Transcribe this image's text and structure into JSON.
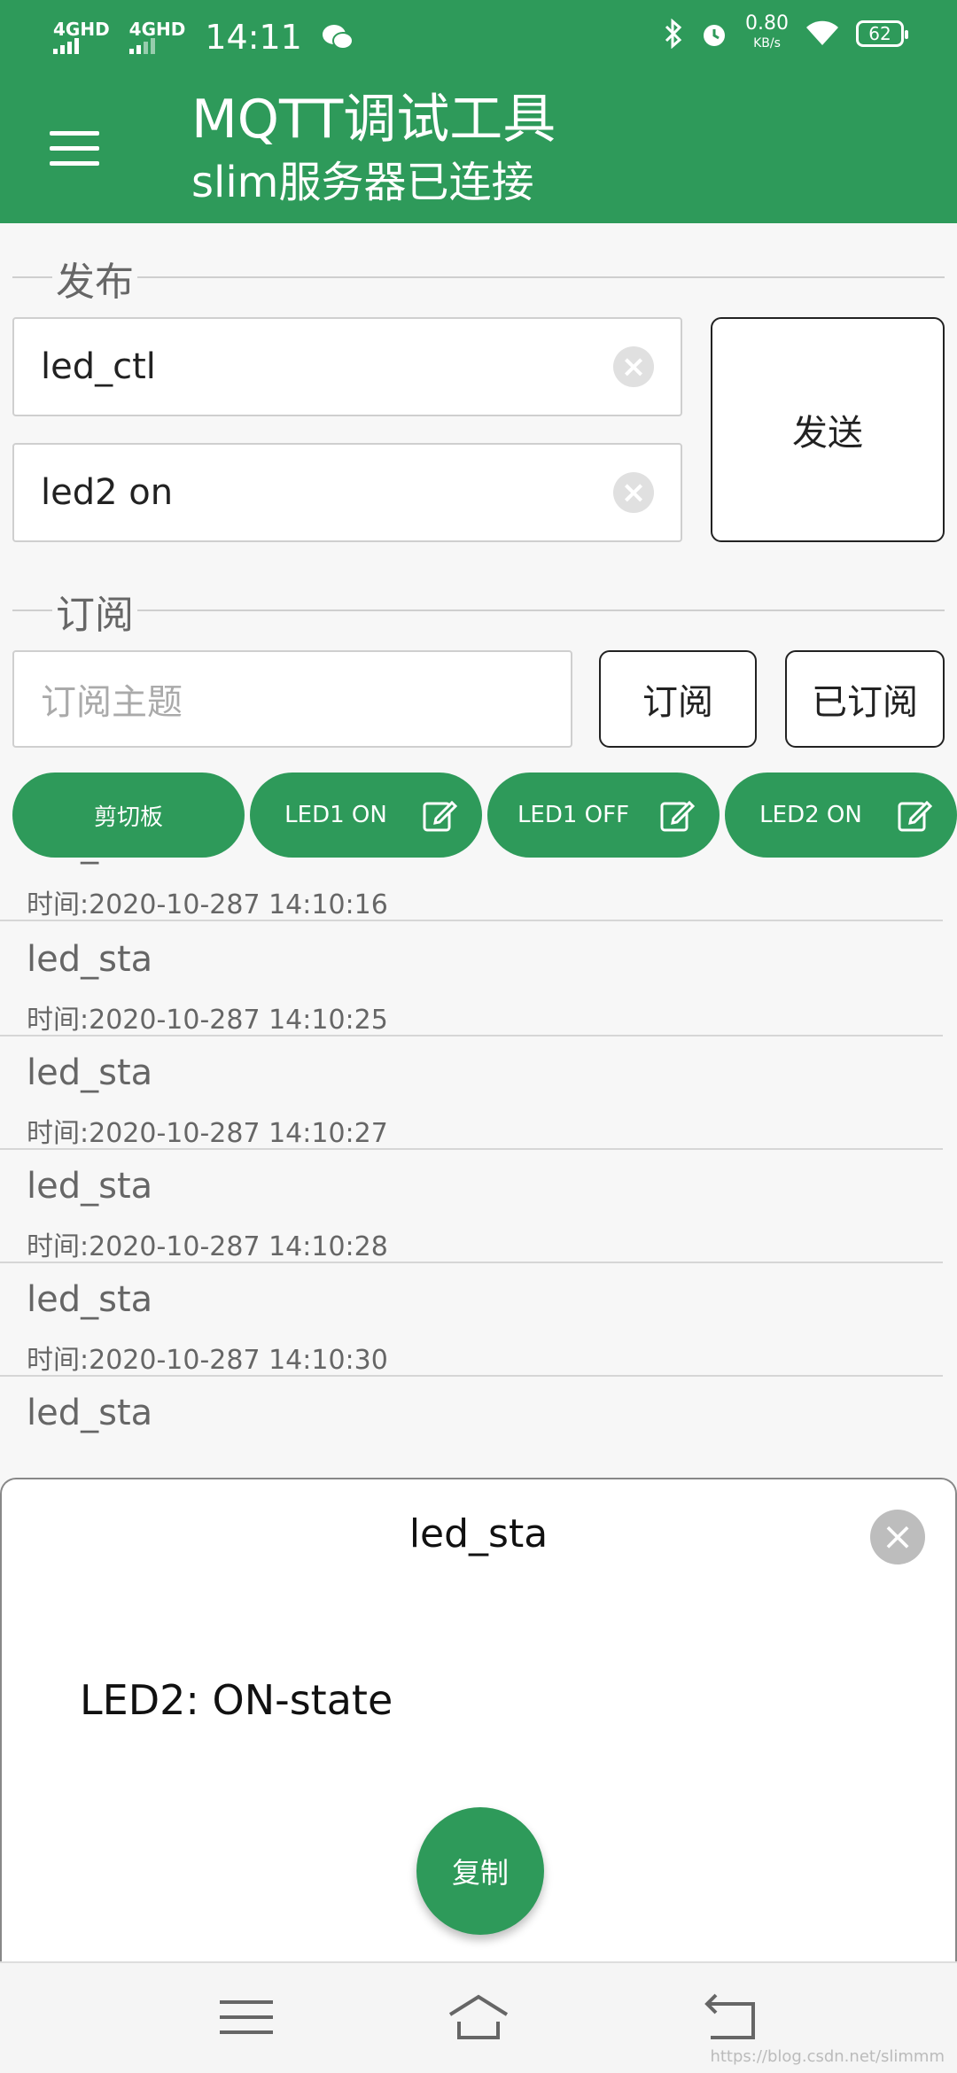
{
  "status_bar": {
    "signal1": "4GHD",
    "signal2": "4GHD",
    "time": "14:11",
    "net_speed": "0.80",
    "net_speed_unit": "KB/s",
    "battery": "62"
  },
  "appbar": {
    "title": "MQTT调试工具",
    "subtitle": "slim服务器已连接"
  },
  "publish": {
    "section_label": "发布",
    "topic_value": "led_ctl",
    "message_value": "led2 on",
    "send_label": "发送"
  },
  "subscribe": {
    "section_label": "订阅",
    "topic_placeholder": "订阅主题",
    "subscribe_label": "订阅",
    "subscribed_label": "已订阅"
  },
  "chips": {
    "clipboard": "剪切板",
    "led1_on": "LED1 ON",
    "led1_off": "LED1 OFF",
    "led2_on": "LED2 ON"
  },
  "messages": [
    {
      "topic": "led_sta",
      "time": "时间:2020-10-287 14:10:16"
    },
    {
      "topic": "led_sta",
      "time": "时间:2020-10-287 14:10:25"
    },
    {
      "topic": "led_sta",
      "time": "时间:2020-10-287 14:10:27"
    },
    {
      "topic": "led_sta",
      "time": "时间:2020-10-287 14:10:28"
    },
    {
      "topic": "led_sta",
      "time": "时间:2020-10-287 14:10:30"
    },
    {
      "topic": "led_sta",
      "time": ""
    }
  ],
  "dialog": {
    "title": "led_sta",
    "content": "LED2: ON-state",
    "copy_label": "复制"
  },
  "watermark": "https://blog.csdn.net/slimmm"
}
